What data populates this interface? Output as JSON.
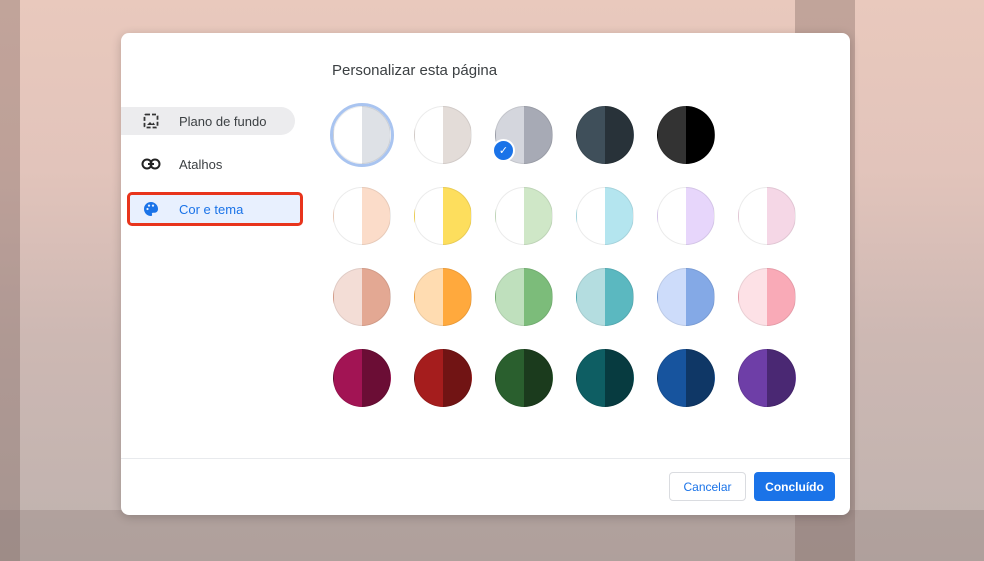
{
  "dialog": {
    "title": "Personalizar esta página"
  },
  "sidebar": {
    "items": [
      {
        "label": "Plano de fundo",
        "icon": "image-icon"
      },
      {
        "label": "Atalhos",
        "icon": "link-icon"
      },
      {
        "label": "Cor e tema",
        "icon": "palette-icon"
      }
    ]
  },
  "swatches": [
    [
      "#ffffff",
      "#dee1e6"
    ],
    [
      "#ffffff",
      "#e3dcd8"
    ],
    [
      "#d4d6dd",
      "#a7aab5"
    ],
    [
      "#3f4f5a",
      "#283239"
    ],
    [
      "#333333",
      "#000000"
    ],
    [
      "#ffffff",
      "#fbdcc9"
    ],
    [
      "#ffffff",
      "#fdde5d"
    ],
    [
      "#ffffff",
      "#cfe7c7"
    ],
    [
      "#ffffff",
      "#b4e5ef"
    ],
    [
      "#ffffff",
      "#e7d6fb"
    ],
    [
      "#ffffff",
      "#f5d7e6"
    ],
    [
      "#f3ddd6",
      "#e3a893"
    ],
    [
      "#ffdcb1",
      "#ffa93d"
    ],
    [
      "#bfe0bd",
      "#7cbc7a"
    ],
    [
      "#b4dde0",
      "#5bb8c0"
    ],
    [
      "#cddcfa",
      "#84a9e6"
    ],
    [
      "#fde1e6",
      "#f9aab7"
    ],
    [
      "#a21454",
      "#6b0d35"
    ],
    [
      "#a51d1d",
      "#711414"
    ],
    [
      "#2a5f2e",
      "#1b3b1d"
    ],
    [
      "#0e5e63",
      "#073b40"
    ],
    [
      "#17549e",
      "#0f3766"
    ],
    [
      "#6e3ea7",
      "#4a2873"
    ]
  ],
  "selected_swatch": 0,
  "footer": {
    "cancel": "Cancelar",
    "done": "Concluído"
  }
}
